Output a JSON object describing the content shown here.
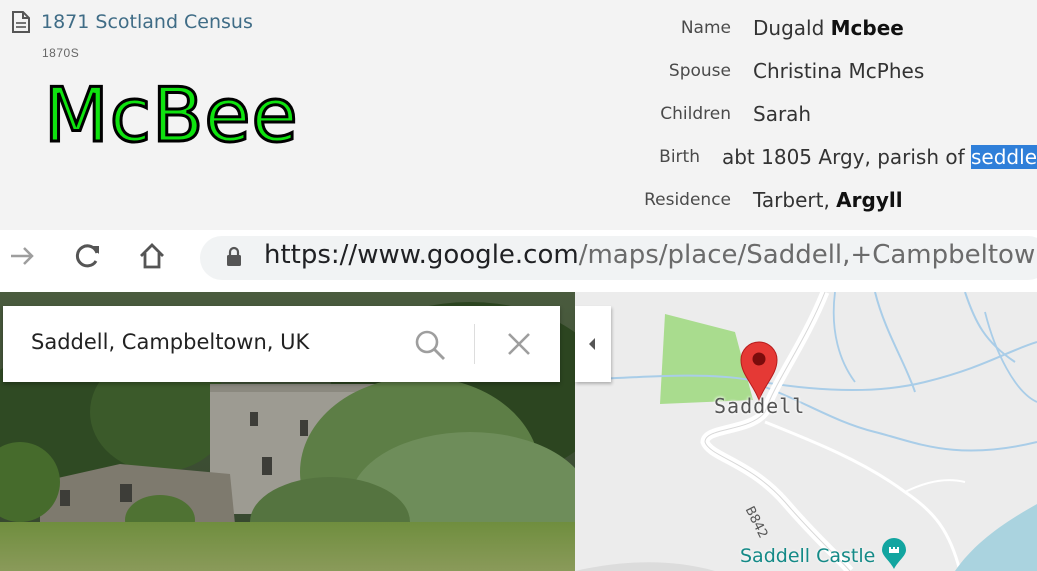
{
  "census": {
    "record_title": "1871 Scotland Census",
    "record_year": "1870S",
    "surname_banner": "McBee",
    "facts": [
      {
        "label": "Name",
        "value_plain": "Dugald ",
        "value_bold": "Mcbee",
        "value_highlight": ""
      },
      {
        "label": "Spouse",
        "value_plain": "Christina McPhes",
        "value_bold": "",
        "value_highlight": ""
      },
      {
        "label": "Children",
        "value_plain": "Sarah",
        "value_bold": "",
        "value_highlight": ""
      },
      {
        "label": "Birth",
        "value_plain": "abt 1805 Argy, parish of ",
        "value_bold": "",
        "value_highlight": "seddle"
      },
      {
        "label": "Residence",
        "value_plain": "Tarbert, ",
        "value_bold": "Argyll",
        "value_highlight": ""
      }
    ],
    "colors": {
      "link": "#3f6c86",
      "banner_fill": "#0fe30f",
      "highlight": "#2f7fd9"
    }
  },
  "browser": {
    "icons": [
      "forward-arrow-icon",
      "reload-icon",
      "home-icon",
      "lock-icon"
    ],
    "url_domain": "https://www.google.com",
    "url_rest": "/maps/place/Saddell,+Campbeltown+"
  },
  "maps": {
    "search_value": "Saddell, Campbeltown, UK",
    "place_label": "Saddell",
    "road_label": "B842",
    "poi_label": "Saddell Castle",
    "icons": [
      "search-icon",
      "close-icon",
      "collapse-arrow-icon",
      "map-pin-icon",
      "landmark-pin-icon"
    ]
  }
}
